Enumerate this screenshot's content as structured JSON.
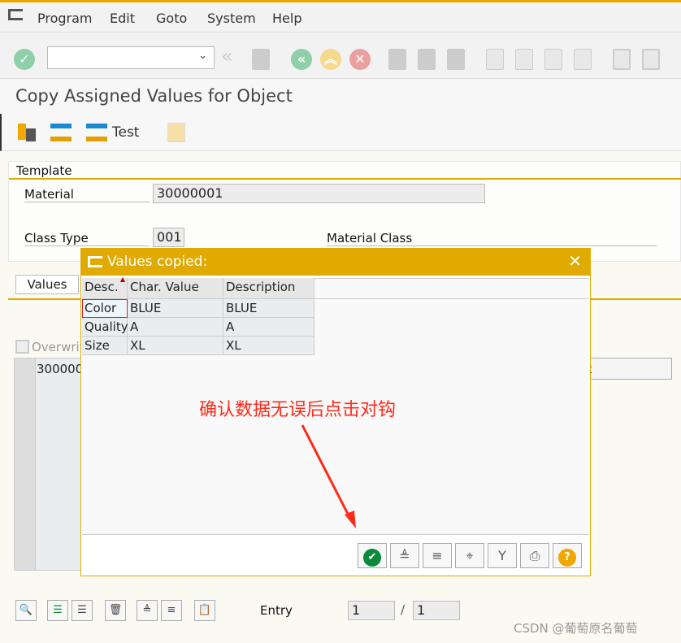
{
  "menu": {
    "items": [
      "Program",
      "Edit",
      "Goto",
      "System",
      "Help"
    ]
  },
  "toolbar": {
    "command_value": "",
    "icons": [
      "enter-icon",
      "back-icon",
      "save-icon",
      "back-green-icon",
      "exit-icon",
      "cancel-icon",
      "print-icon",
      "find-icon",
      "find-next-icon",
      "first-page-icon",
      "prev-page-icon",
      "next-page-icon",
      "last-page-icon",
      "create-session-icon",
      "shortcut-icon"
    ]
  },
  "title": "Copy Assigned Values for Object",
  "app_toolbar": {
    "test_label": "Test"
  },
  "template": {
    "group_label": "Template",
    "material_label": "Material",
    "material_value": "30000001",
    "class_type_label": "Class Type",
    "class_type_value": "001",
    "material_class_label": "Material Class"
  },
  "tabs": [
    "Values"
  ],
  "overwrite_label": "Overwrit",
  "bg_table": {
    "first_cell": "300000",
    "right_field": "ect"
  },
  "dialog": {
    "title": "Values copied:",
    "columns": [
      "Desc.",
      "Char. Value",
      "Description"
    ],
    "rows": [
      [
        "Color",
        "BLUE",
        "BLUE"
      ],
      [
        "Quality",
        "A",
        "A"
      ],
      [
        "Size",
        "XL",
        "XL"
      ]
    ],
    "buttons": [
      "confirm-icon",
      "sort-ascending-icon",
      "sort-descending-icon",
      "find-icon",
      "filter-icon",
      "print-icon",
      "help-icon"
    ]
  },
  "annotation": {
    "text": "确认数据无误后点击对钩",
    "color": "#ff2a1a"
  },
  "bottom": {
    "entry_label": "Entry",
    "entry_value": "1",
    "separator": "/",
    "total_value": "1"
  },
  "watermark": "CSDN @葡萄原名葡萄",
  "colors": {
    "accent": "#e0aa00",
    "confirm": "#0a8a3a"
  }
}
